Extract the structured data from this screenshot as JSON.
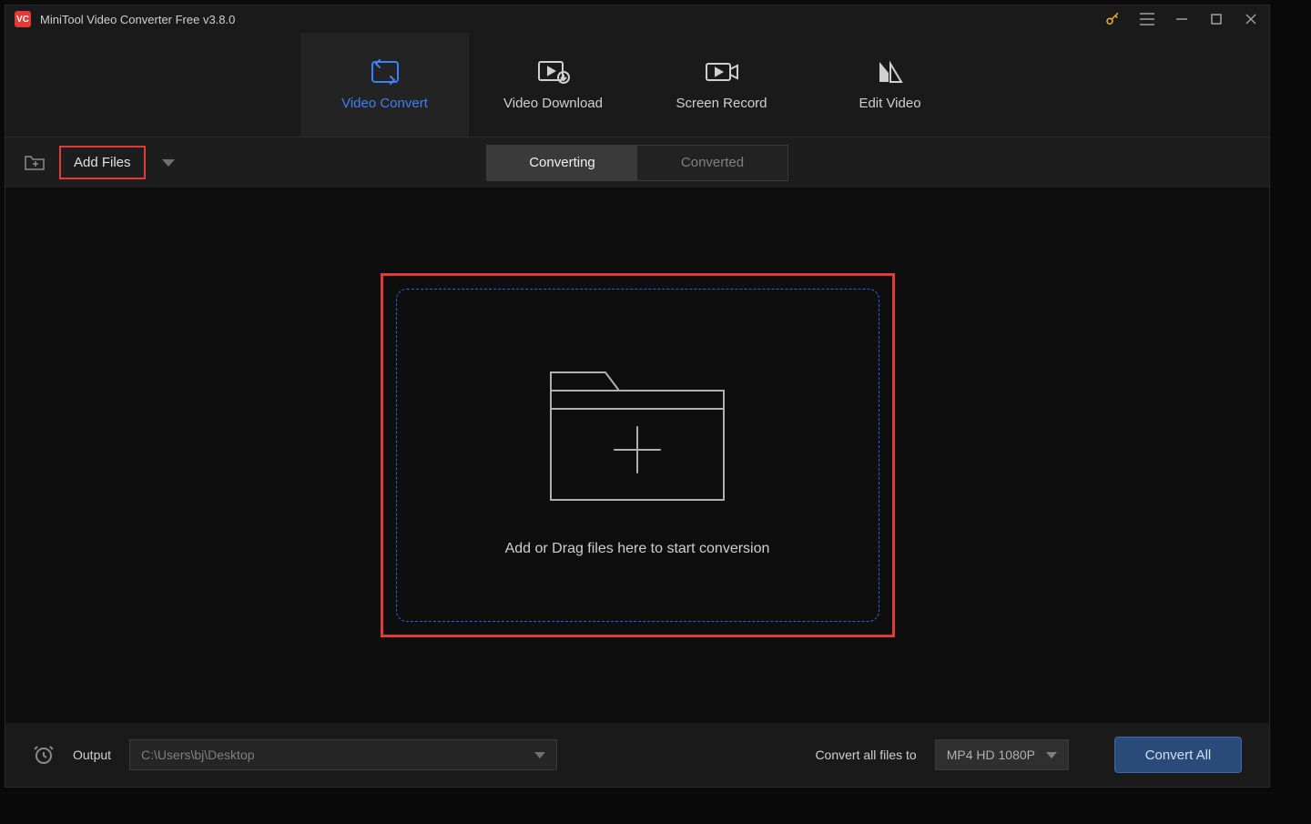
{
  "titlebar": {
    "app_title": "MiniTool Video Converter Free v3.8.0"
  },
  "main_tabs": [
    {
      "label": "Video Convert",
      "active": true
    },
    {
      "label": "Video Download",
      "active": false
    },
    {
      "label": "Screen Record",
      "active": false
    },
    {
      "label": "Edit Video",
      "active": false
    }
  ],
  "toolbar": {
    "add_files_label": "Add Files"
  },
  "sub_tabs": [
    {
      "label": "Converting",
      "active": true
    },
    {
      "label": "Converted",
      "active": false
    }
  ],
  "dropzone": {
    "message": "Add or Drag files here to start conversion"
  },
  "bottom": {
    "output_label": "Output",
    "output_path": "C:\\Users\\bj\\Desktop",
    "convert_label": "Convert all files to",
    "format_selected": "MP4 HD 1080P",
    "convert_all_label": "Convert All"
  },
  "colors": {
    "accent_blue": "#3b82f6",
    "highlight_red": "#e53935"
  }
}
